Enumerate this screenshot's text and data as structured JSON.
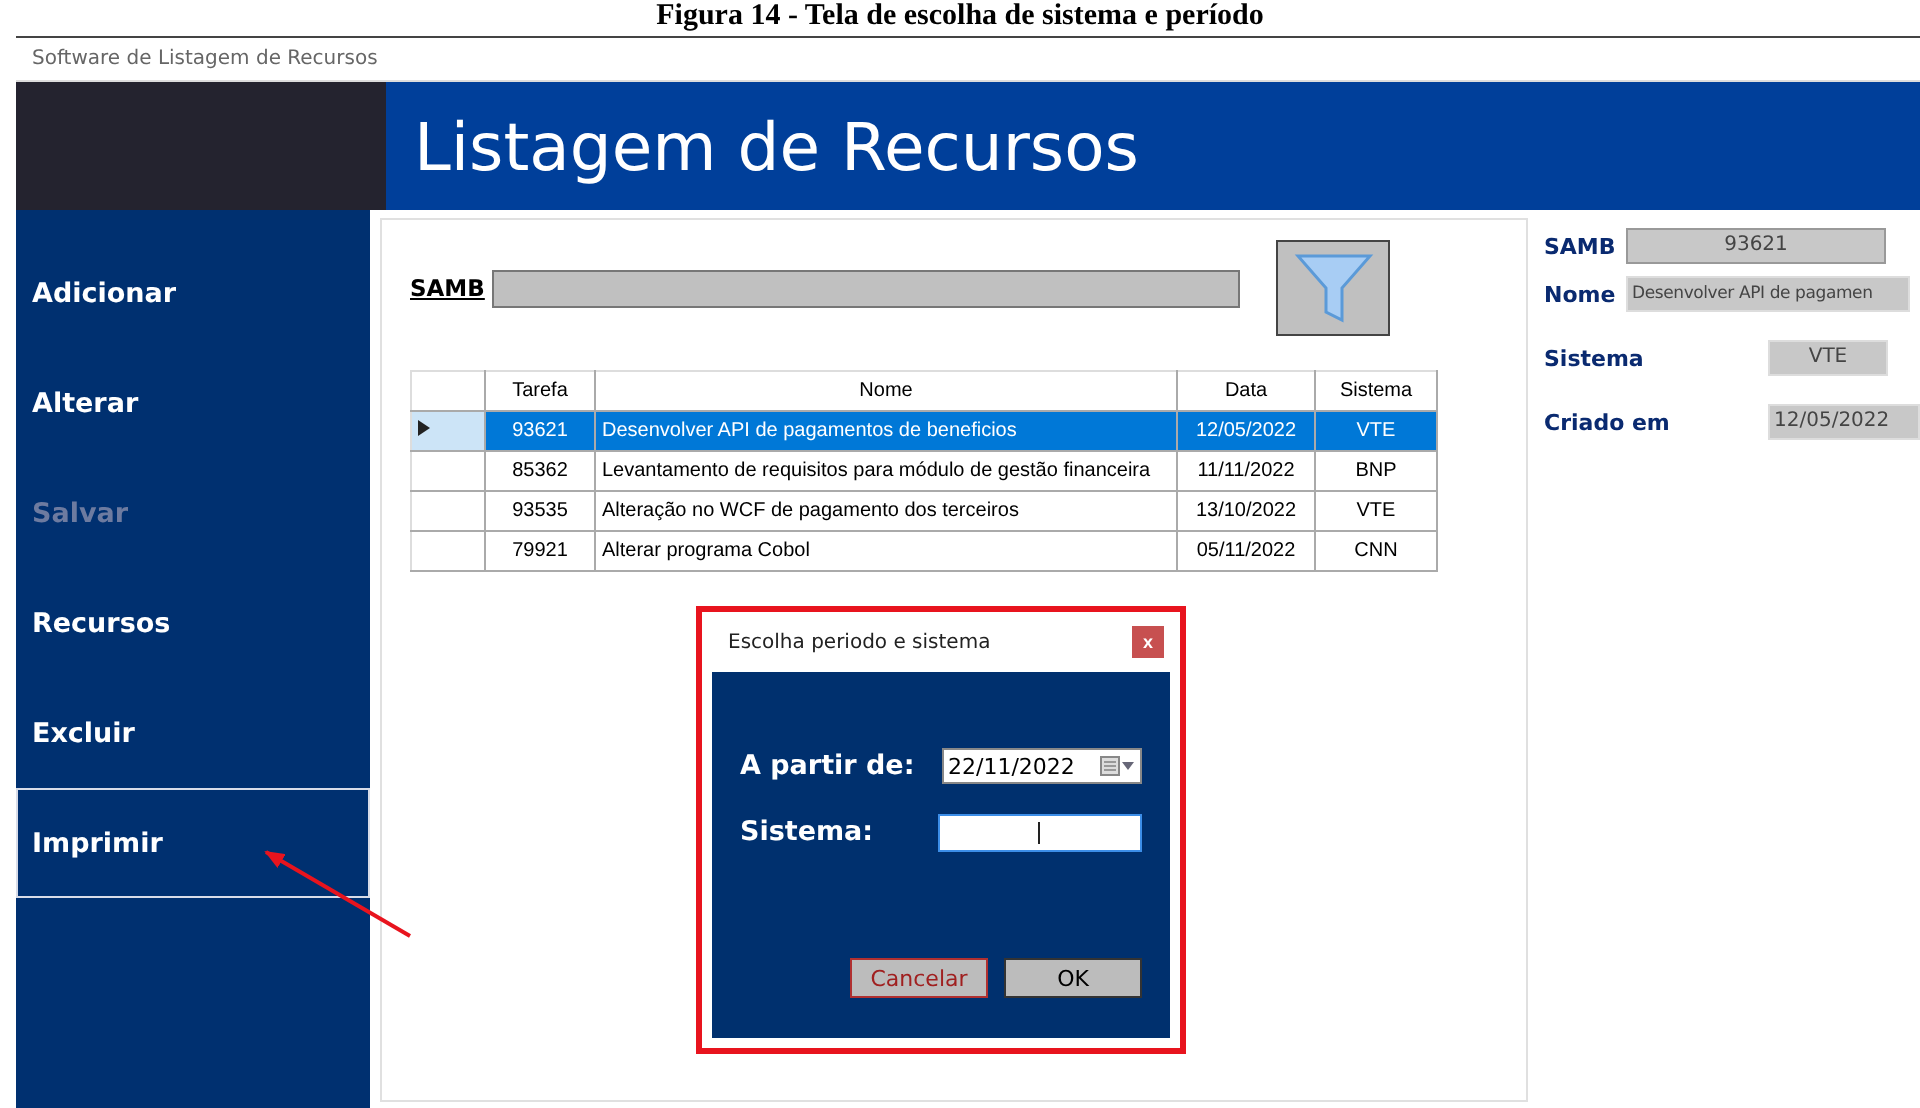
{
  "caption": "Figura 14 - Tela de escolha de sistema e período",
  "window": {
    "title": "Software de Listagem de Recursos"
  },
  "header": {
    "title": "Listagem de Recursos"
  },
  "sidebar": {
    "items": [
      {
        "label": "Adicionar",
        "selected": false,
        "disabled": false
      },
      {
        "label": "Alterar",
        "selected": false,
        "disabled": false
      },
      {
        "label": "Salvar",
        "selected": false,
        "disabled": true
      },
      {
        "label": "Recursos",
        "selected": false,
        "disabled": false
      },
      {
        "label": "Excluir",
        "selected": false,
        "disabled": false
      },
      {
        "label": "Imprimir",
        "selected": true,
        "disabled": false
      }
    ]
  },
  "filter": {
    "label": "SAMB"
  },
  "table": {
    "columns": [
      "Tarefa",
      "Nome",
      "Data",
      "Sistema"
    ],
    "rows": [
      {
        "cells": [
          "93621",
          "Desenvolver API de pagamentos de beneficios",
          "12/05/2022",
          "VTE"
        ],
        "selected": true
      },
      {
        "cells": [
          "85362",
          "Levantamento de requisitos para módulo de gestão financeira",
          "11/11/2022",
          "BNP"
        ],
        "selected": false
      },
      {
        "cells": [
          "93535",
          "Alteração no WCF de pagamento dos terceiros",
          "13/10/2022",
          "VTE"
        ],
        "selected": false
      },
      {
        "cells": [
          "79921",
          "Alterar programa Cobol",
          "05/11/2022",
          "CNN"
        ],
        "selected": false
      }
    ]
  },
  "details": {
    "fields": [
      {
        "label": "SAMB",
        "value": "93621",
        "kind": "center"
      },
      {
        "label": "Nome",
        "value": "Desenvolver API de pagamen",
        "kind": "left"
      },
      {
        "label": "Sistema",
        "value": "VTE",
        "kind": "short"
      },
      {
        "label": "Criado em",
        "value": "12/05/2022",
        "kind": "date"
      }
    ]
  },
  "dialog": {
    "title": "Escolha periodo e sistema",
    "close": "x",
    "fields": [
      {
        "label": "A partir de:",
        "value": "22/11/2022",
        "kind": "date",
        "focused": false
      },
      {
        "label": "Sistema:",
        "kind": "text",
        "focused": true
      }
    ],
    "buttons": [
      {
        "label": "Cancelar",
        "kind": "cancel"
      },
      {
        "label": "OK",
        "kind": "ok"
      }
    ]
  }
}
